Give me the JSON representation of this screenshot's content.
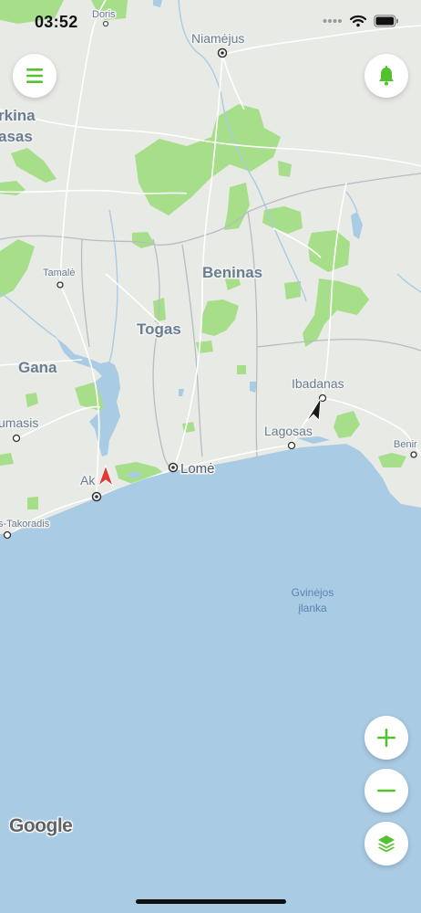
{
  "status_bar": {
    "time": "03:52"
  },
  "colors": {
    "land": "#e8eae6",
    "ocean": "#a9cbe3",
    "green": "#a6de8a",
    "accent": "#53c22e",
    "roads": "#ffffff",
    "borders": "#b8bcc2"
  },
  "map": {
    "countries": {
      "burkina_a": "rkina",
      "burkina_b": "asas",
      "gana": "Gana",
      "togas": "Togas",
      "beninas": "Beninas"
    },
    "cities": {
      "doris": "Doris",
      "niamejus": "Niamėjus",
      "tamale": "Tamalė",
      "kumasis": "umasis",
      "takoradis": "s-Takoradis",
      "akra": "Ak",
      "lome": "Lomė",
      "ibadanas": "Ibadanas",
      "lagosas": "Lagosas",
      "benin_city": "Benir"
    },
    "water": {
      "gulf_line1": "Gvinėjos",
      "gulf_line2": "įlanka"
    }
  },
  "controls": {
    "menu_icon": "hamburger-menu-icon",
    "notifications_icon": "bell-icon",
    "zoom_in_icon": "plus-icon",
    "zoom_out_icon": "minus-icon",
    "layers_icon": "layers-icon"
  },
  "attribution": {
    "logo_text": "Google"
  }
}
